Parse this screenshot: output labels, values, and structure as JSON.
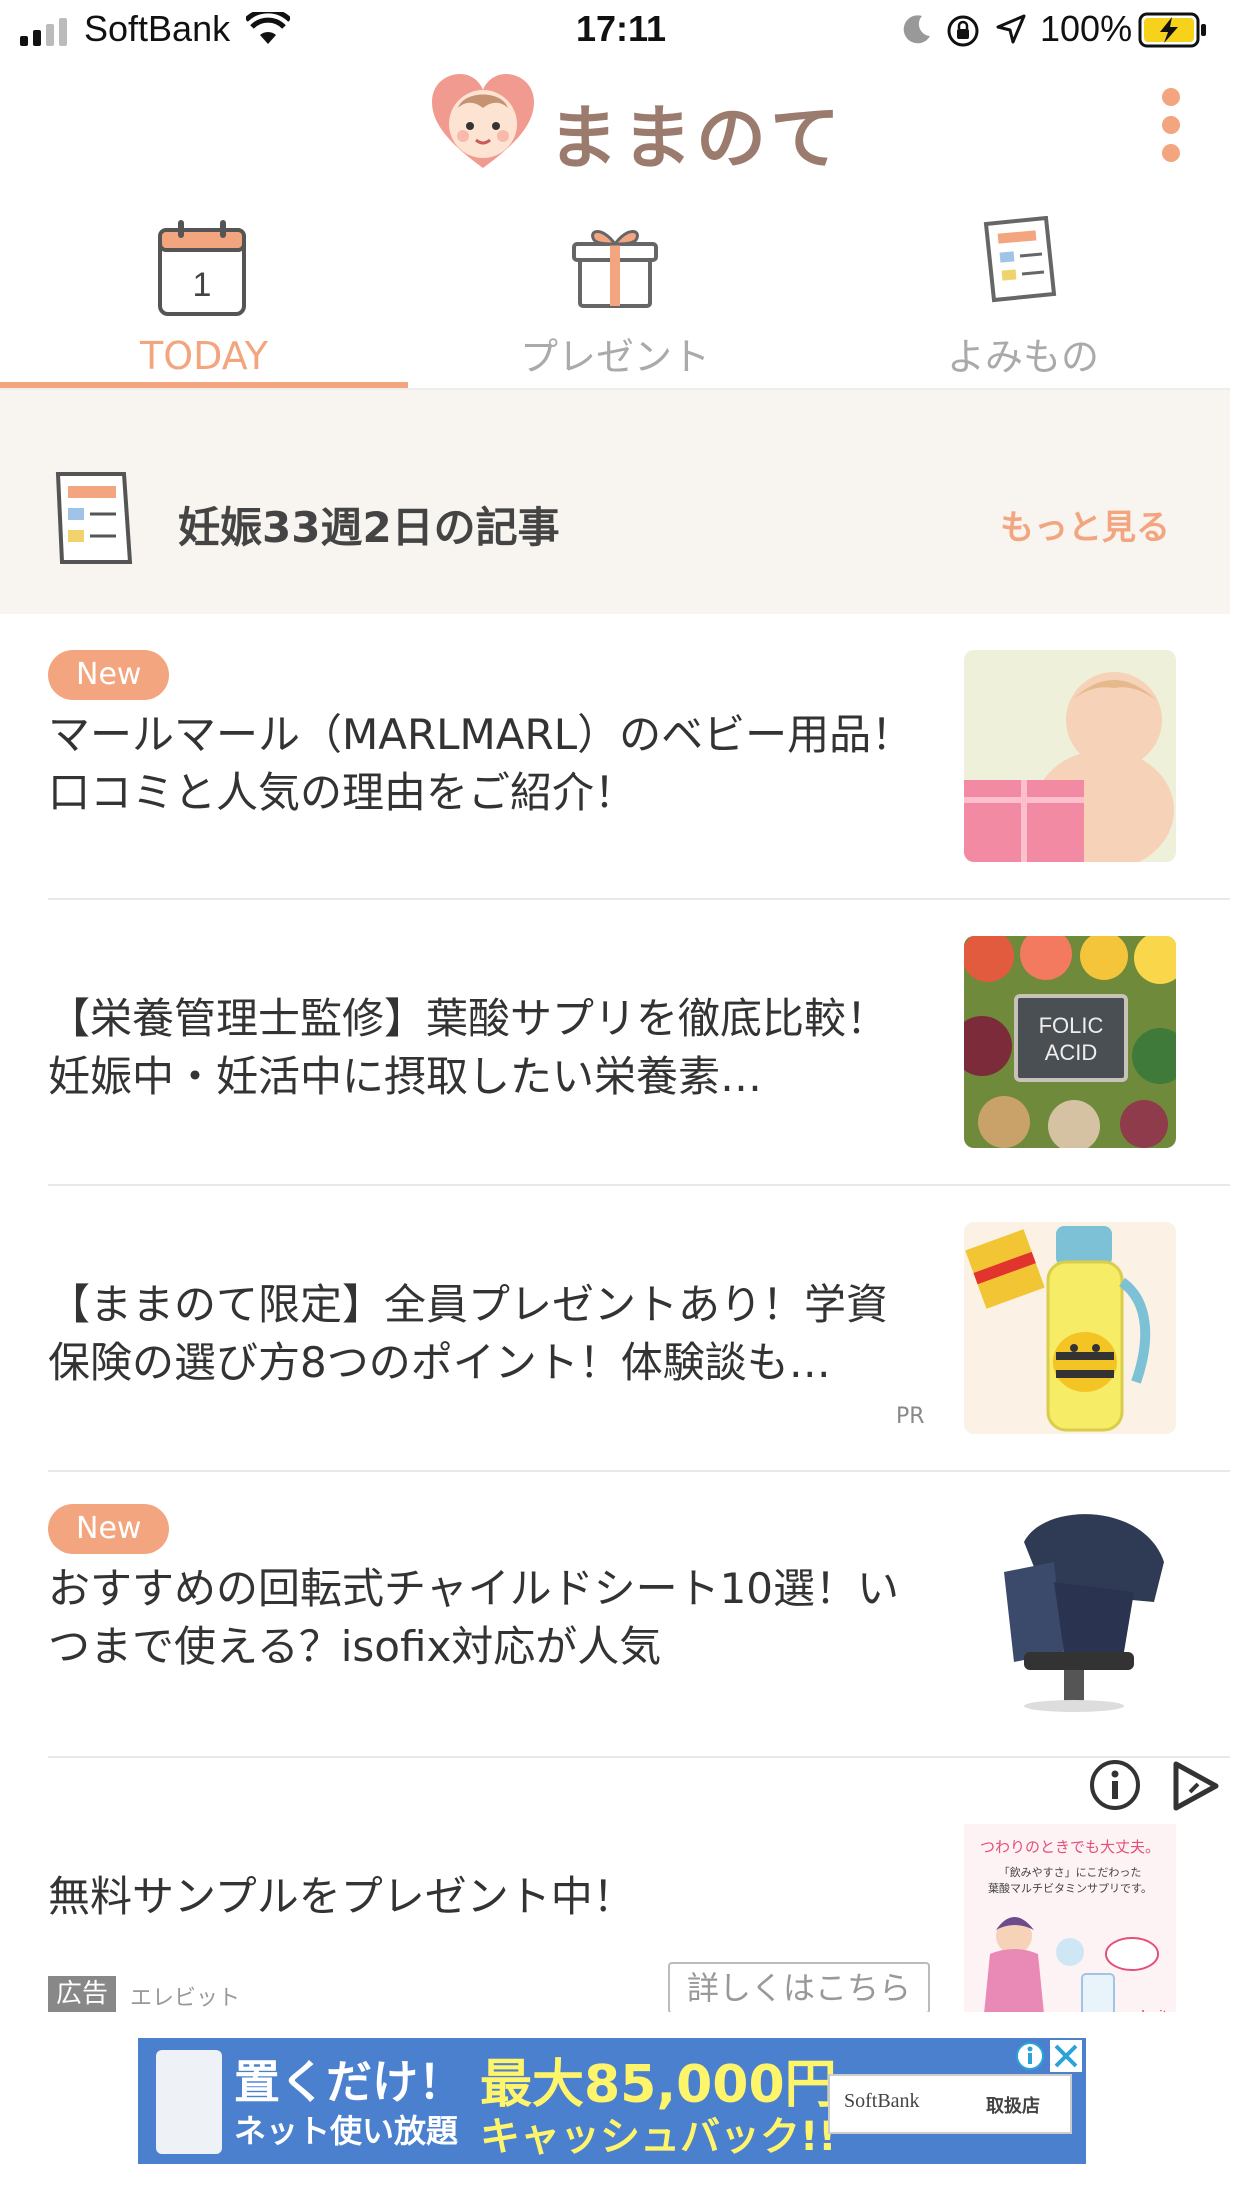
{
  "status_bar": {
    "carrier": "SoftBank",
    "time": "17:11",
    "battery": "100%"
  },
  "app": {
    "name": "ままのて"
  },
  "tabs": [
    {
      "label": "TODAY",
      "icon": "calendar-icon",
      "icon_text": "1",
      "active": true
    },
    {
      "label": "プレゼント",
      "icon": "gift-icon",
      "active": false
    },
    {
      "label": "よみもの",
      "icon": "document-icon",
      "active": false
    }
  ],
  "section": {
    "title": "妊娠33週2日の記事",
    "more_label": "もっと見る"
  },
  "articles": [
    {
      "badge": "New",
      "title": "マールマール（MARLMARL）のベビー用品！口コミと人気の理由をご紹介！",
      "pr": "",
      "thumb": "baby-with-gift"
    },
    {
      "badge": "",
      "title": "【栄養管理士監修】葉酸サプリを徹底比較！妊娠中・妊活中に摂取したい栄養素…",
      "pr": "",
      "thumb": "folic-acid-foods",
      "thumb_text": "FOLIC ACID"
    },
    {
      "badge": "",
      "title": "【ままのて限定】全員プレゼントあり！学資保険の選び方8つのポイント！体験談も…",
      "pr": "PR",
      "thumb": "bee-bottle"
    },
    {
      "badge": "New",
      "title": "おすすめの回転式チャイルドシート10選！いつまで使える？isofix対応が人気",
      "pr": "",
      "thumb": "child-seat"
    }
  ],
  "ad": {
    "title": "無料サンプルをプレゼント中！",
    "label": "広告",
    "advertiser": "エレビット",
    "button": "詳しくはこちら",
    "image_lines": [
      "つわりのときでも大丈夫。",
      "「飲みやすさ」にこだわった",
      "葉酸マルチビタミンサプリです。"
    ],
    "brand": "elevit"
  },
  "banner": {
    "line1": "置くだけ！",
    "line2": "ネット使い放題",
    "line3": "最大85,000円",
    "line4": "キャッシュバック!!",
    "brand": "SoftBank",
    "store": "取扱店"
  },
  "colors": {
    "accent": "#f2a57f",
    "logo_text": "#9b7b6e",
    "section_bg": "#f8f4ef"
  }
}
